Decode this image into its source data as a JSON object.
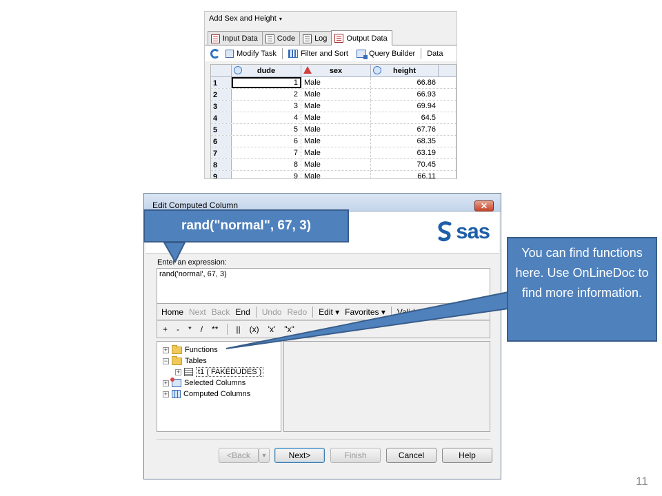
{
  "eg": {
    "title": "Add Sex and Height",
    "title_arrow": "▾",
    "tabs": [
      {
        "label": "Input Data",
        "active": false
      },
      {
        "label": "Code",
        "active": false
      },
      {
        "label": "Log",
        "active": false
      },
      {
        "label": "Output Data",
        "active": true
      }
    ],
    "toolbar": {
      "modify_task": "Modify Task",
      "filter_sort": "Filter and Sort",
      "query_builder": "Query Builder",
      "data": "Data"
    },
    "columns": [
      "dude",
      "sex",
      "height"
    ],
    "rows": [
      {
        "n": "1",
        "dude": "1",
        "sex": "Male",
        "height": "66.86"
      },
      {
        "n": "2",
        "dude": "2",
        "sex": "Male",
        "height": "66.93"
      },
      {
        "n": "3",
        "dude": "3",
        "sex": "Male",
        "height": "69.94"
      },
      {
        "n": "4",
        "dude": "4",
        "sex": "Male",
        "height": "64.5"
      },
      {
        "n": "5",
        "dude": "5",
        "sex": "Male",
        "height": "67.76"
      },
      {
        "n": "6",
        "dude": "6",
        "sex": "Male",
        "height": "68.35"
      },
      {
        "n": "7",
        "dude": "7",
        "sex": "Male",
        "height": "63.19"
      },
      {
        "n": "8",
        "dude": "8",
        "sex": "Male",
        "height": "70.45"
      },
      {
        "n": "9",
        "dude": "9",
        "sex": "Male",
        "height": "66.11"
      }
    ]
  },
  "dialog": {
    "title": "Edit Computed Column",
    "close": "✕",
    "logo_text": "sas",
    "expression_label": "Enter an expression:",
    "expression_value": "rand('normal', 67, 3)",
    "edit_toolbar": {
      "home": "Home",
      "next": "Next",
      "back": "Back",
      "end": "End",
      "undo": "Undo",
      "redo": "Redo",
      "edit": "Edit ▾",
      "favorites": "Favorites ▾",
      "validate": "Validate"
    },
    "operators": [
      "+",
      "-",
      "*",
      "/",
      "**",
      "||",
      "(x)",
      "'x'",
      "\"x\""
    ],
    "tree": {
      "functions": "Functions",
      "tables": "Tables",
      "t1": "t1 ( FAKEDUDES )",
      "selected_columns": "Selected Columns",
      "computed_columns": "Computed Columns",
      "expand": "+",
      "collapse": "−"
    },
    "buttons": {
      "back": "<Back",
      "next": "Next>",
      "finish": "Finish",
      "cancel": "Cancel",
      "help": "Help"
    }
  },
  "callouts": {
    "expression": "rand(\"normal\", 67, 3)",
    "functions": "You can find functions here. Use OnLineDoc to find more information."
  },
  "colors": {
    "callout_fill": "#4f81bd",
    "callout_border": "#385d8a",
    "sas_blue": "#1f5ea8"
  },
  "page_number": "11"
}
